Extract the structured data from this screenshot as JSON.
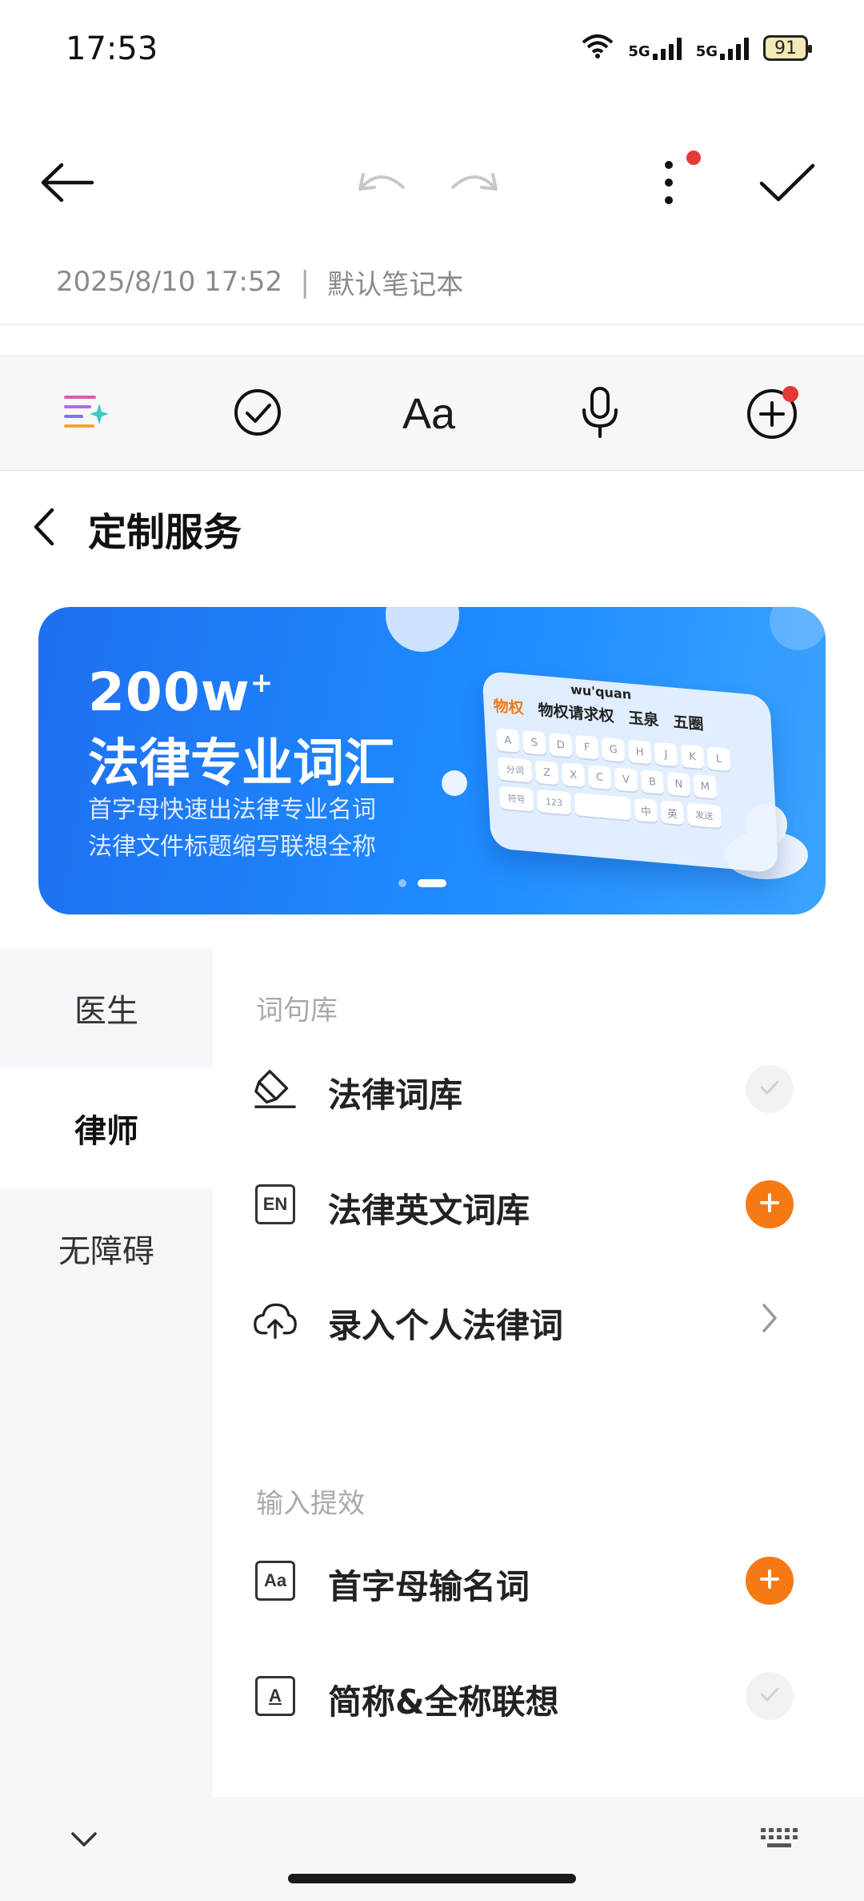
{
  "status_bar": {
    "time": "17:53",
    "network_1": "5G",
    "network_2": "5G",
    "battery": "91",
    "icons": [
      "wifi-icon",
      "signal-icon",
      "signal-icon",
      "battery-icon"
    ]
  },
  "toolbar": {
    "icons": [
      "back-arrow-icon",
      "undo-icon",
      "redo-icon",
      "more-vertical-icon",
      "check-icon"
    ],
    "accent_red": "#e53935"
  },
  "note_meta": {
    "datetime": "2025/8/10 17:52",
    "separator": "|",
    "notebook": "默认笔记本"
  },
  "format_toolbar": {
    "icons": [
      "ai-format-icon",
      "checklist-icon",
      "text-style-icon",
      "microphone-icon",
      "add-circle-icon"
    ],
    "text_style_label": "Aa"
  },
  "panel": {
    "title": "定制服务"
  },
  "banner": {
    "title_line_1": "200w",
    "title_sup": "+",
    "title_line_2": "法律专业词汇",
    "sub_line_1": "首字母快速出法律专业名词",
    "sub_line_2": "法律文件标题缩写联想全称",
    "kbd_pinyin": "wu'quan",
    "kbd_candidates": [
      "物权",
      "物权请求权",
      "玉泉",
      "五圈"
    ],
    "kbd_keys_row1": [
      "A",
      "S",
      "D",
      "F",
      "G",
      "H",
      "J",
      "K",
      "L"
    ],
    "kbd_keys_row2": [
      "分词",
      "Z",
      "X",
      "C",
      "V",
      "B",
      "N",
      "M"
    ],
    "kbd_keys_row3": [
      "符号",
      "123",
      "中",
      "英",
      "发送"
    ],
    "page_count": 2,
    "page_index": 1
  },
  "categories": [
    {
      "label": "医生",
      "active": false
    },
    {
      "label": "律师",
      "active": true
    },
    {
      "label": "无障碍",
      "active": false
    }
  ],
  "sections": [
    {
      "label": "词句库",
      "items": [
        {
          "label": "法律词库",
          "icon": "eraser-icon",
          "action": "done"
        },
        {
          "label": "法律英文词库",
          "icon": "en-box-icon",
          "action": "add"
        },
        {
          "label": "录入个人法律词",
          "icon": "cloud-upload-icon",
          "action": "arrow"
        }
      ]
    },
    {
      "label": "输入提效",
      "items": [
        {
          "label": "首字母输名词",
          "icon": "aa-box-icon",
          "action": "add"
        },
        {
          "label": "简称&全称联想",
          "icon": "a-box-icon",
          "action": "done"
        }
      ]
    }
  ],
  "colors": {
    "add_orange": "#f67a13",
    "banner_blue": "#1e8bff"
  },
  "bottom_bar": {
    "icons": [
      "chevron-down-icon",
      "keyboard-icon"
    ]
  }
}
